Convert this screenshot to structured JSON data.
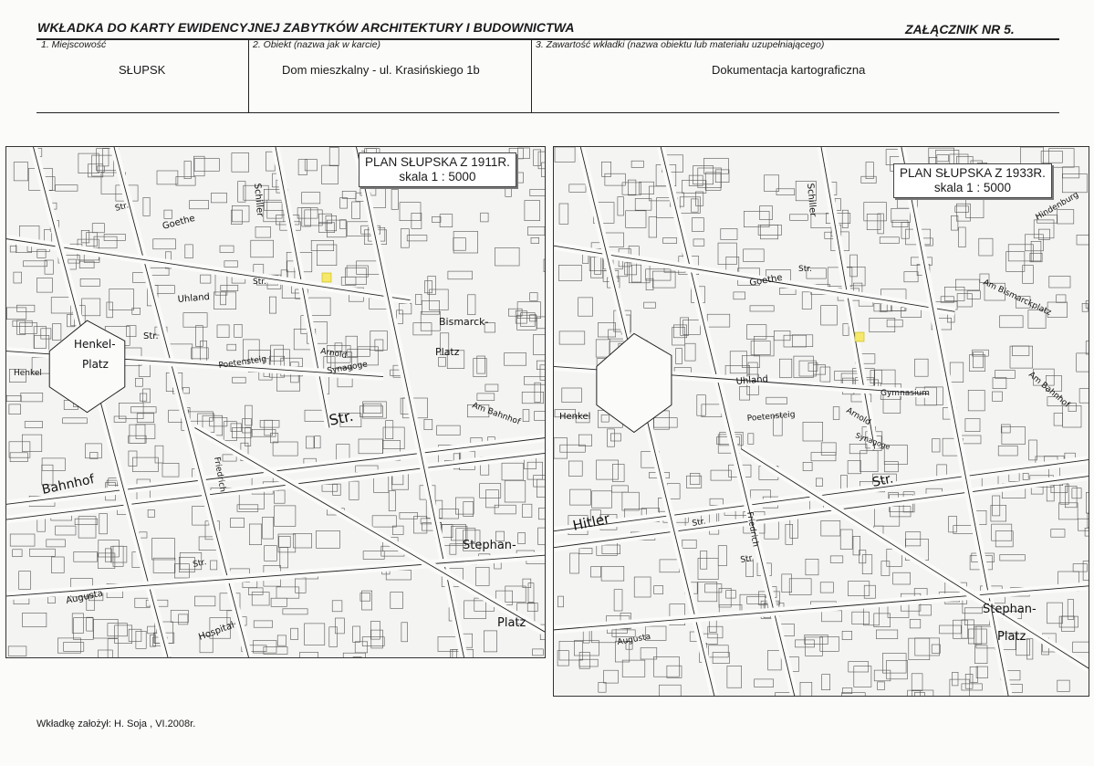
{
  "header": {
    "title": "WKŁADKA DO KARTY EWIDENCYJNEJ ZABYTKÓW ARCHITEKTURY I BUDOWNICTWA",
    "annex": "ZAŁĄCZNIK NR 5."
  },
  "fields": [
    {
      "label": "1. Miejscowość",
      "value": "SŁUPSK"
    },
    {
      "label": "2. Obiekt (nazwa jak w karcie)",
      "value": "Dom mieszkalny - ul. Krasińskiego 1b"
    },
    {
      "label": "3. Zawartość wkładki (nazwa obiektu lub materiału uzupełniającego)",
      "value": "Dokumentacja kartograficzna"
    }
  ],
  "maps": [
    {
      "title": "PLAN SŁUPSKA Z 1911R.",
      "scale": "skala 1 : 5000",
      "streets": [
        "Schiller",
        "Goethe",
        "Str.",
        "Str.",
        "Uhland",
        "Henkel-",
        "Platz",
        "Henkel",
        "Poetensteig",
        "Arnold",
        "Str.",
        "Bahnhof",
        "Str.",
        "Augusta",
        "Hospital",
        "Stephan-",
        "Platz",
        "Bismarck-",
        "Platz",
        "Am Bahnhof",
        "Friedrich",
        "Str.",
        "Synagoge"
      ]
    },
    {
      "title": "PLAN SŁUPSKA Z 1933R.",
      "scale": "skala 1 : 5000",
      "streets": [
        "Schiller",
        "Goethe",
        "Str.",
        "Uhland",
        "Henkel",
        "Poetensteig",
        "Arnold",
        "Synagoge",
        "Str.",
        "Hitler",
        "Str.",
        "Augusta",
        "Stephan-",
        "Platz",
        "Am Bismarckplatz",
        "Am Bahnhof",
        "Friedrich",
        "Str.",
        "Gymnasium",
        "Hindenburg"
      ]
    }
  ],
  "footer": "Wkładkę założył: H. Soja , VI.2008r."
}
